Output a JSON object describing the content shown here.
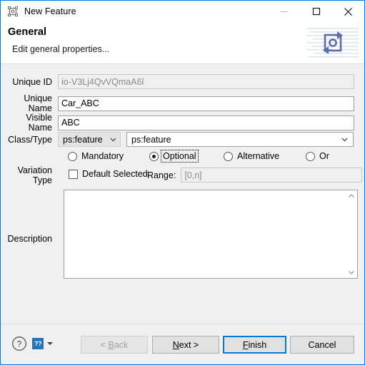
{
  "window": {
    "title": "New Feature",
    "icon": "feature-window-icon",
    "controls": {
      "minimize": "minimize-icon",
      "maximize": "maximize-icon",
      "close": "close-icon"
    },
    "accent_color": "#0078d7",
    "body_color": "#f0f0f0"
  },
  "header": {
    "title": "General",
    "subtitle": "Edit general properties...",
    "banner_icon": "sync-refresh-banner-icon"
  },
  "form": {
    "unique_id": {
      "label": "Unique ID",
      "value": "io-V3Lj4QvVQmaA6l",
      "readonly": true
    },
    "unique_name": {
      "label": "Unique Name",
      "value": "Car_ABC"
    },
    "visible_name": {
      "label": "Visible Name",
      "value": "ABC"
    },
    "class_type": {
      "label": "Class/Type",
      "class_value": "ps:feature",
      "type_value": "ps:feature"
    },
    "variation_type": {
      "label": "Variation Type",
      "options": [
        {
          "label": "Mandatory",
          "selected": false
        },
        {
          "label": "Optional",
          "selected": true,
          "focused": true
        },
        {
          "label": "Alternative",
          "selected": false
        },
        {
          "label": "Or",
          "selected": false
        }
      ],
      "default_selected": {
        "label": "Default Selected",
        "checked": false
      },
      "range": {
        "label": "Range:",
        "value": "[0,n]",
        "disabled": true
      }
    },
    "description": {
      "label": "Description",
      "value": ""
    }
  },
  "footer": {
    "help_icon": "help-circle-icon",
    "help_badge": "??",
    "help_dropdown": "chevron-down-icon",
    "buttons": {
      "back": {
        "label": "< Back",
        "disabled": true
      },
      "next": {
        "label": "Next >",
        "disabled": false
      },
      "finish": {
        "label": "Finish",
        "default": true
      },
      "cancel": {
        "label": "Cancel",
        "disabled": false
      }
    }
  }
}
